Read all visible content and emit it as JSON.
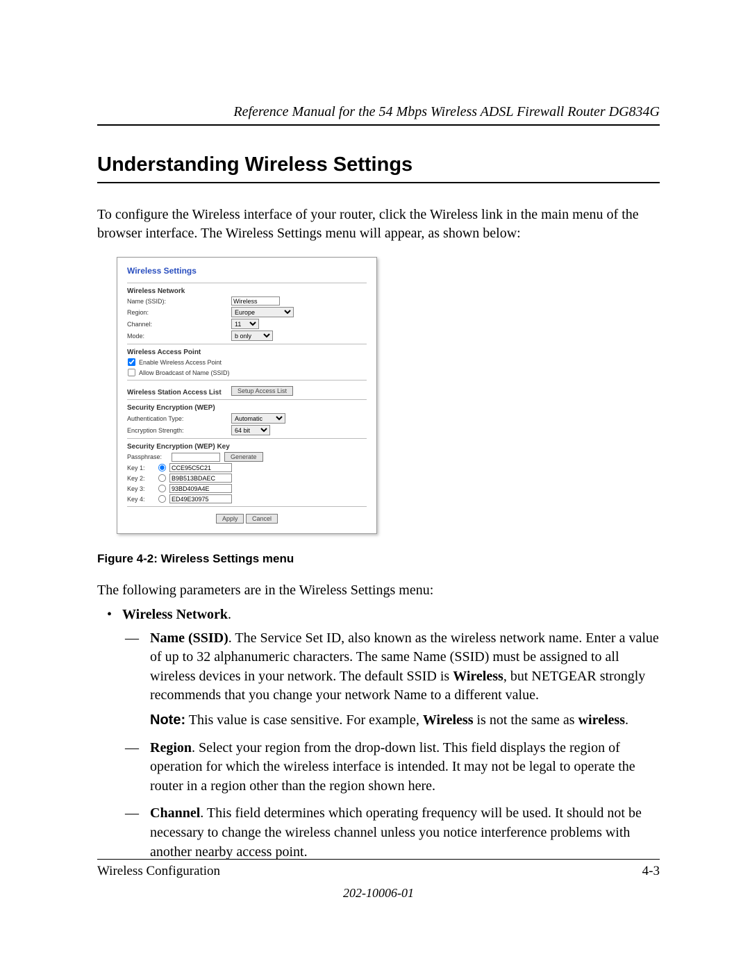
{
  "header": {
    "running_head": "Reference Manual for the 54 Mbps Wireless ADSL Firewall Router DG834G"
  },
  "title": "Understanding Wireless Settings",
  "intro": "To configure the Wireless interface of your router, click the Wireless link in the main menu of the browser interface. The Wireless Settings menu will appear, as shown below:",
  "screenshot": {
    "panel_title": "Wireless Settings",
    "sect_network": "Wireless Network",
    "name_label": "Name (SSID):",
    "name_value": "Wireless",
    "region_label": "Region:",
    "region_value": "Europe",
    "channel_label": "Channel:",
    "channel_value": "11",
    "mode_label": "Mode:",
    "mode_value": "b only",
    "sect_ap": "Wireless Access Point",
    "enable_ap": "Enable Wireless Access Point",
    "allow_broadcast": "Allow Broadcast of Name (SSID)",
    "sect_station": "Wireless Station Access List",
    "setup_access_btn": "Setup Access List",
    "sect_wep": "Security Encryption (WEP)",
    "auth_label": "Authentication Type:",
    "auth_value": "Automatic",
    "strength_label": "Encryption Strength:",
    "strength_value": "64 bit",
    "sect_wep_key": "Security Encryption (WEP) Key",
    "passphrase_label": "Passphrase:",
    "generate_btn": "Generate",
    "key1_label": "Key 1:",
    "key1_value": "CCE95C5C21",
    "key2_label": "Key 2:",
    "key2_value": "B9B513BDAEC",
    "key3_label": "Key 3:",
    "key3_value": "93BD409A4E",
    "key4_label": "Key 4:",
    "key4_value": "ED49E30975",
    "apply_btn": "Apply",
    "cancel_btn": "Cancel"
  },
  "figure_caption": "Figure 4-2:  Wireless Settings menu",
  "following": "The following parameters are in the Wireless Settings menu:",
  "bullets": {
    "wireless_network_head": "Wireless Network",
    "ssid": {
      "head": "Name (SSID)",
      "text_a": ". The Service Set ID, also known as the wireless network name. Enter a value of up to 32 alphanumeric characters. The same Name (SSID) must be assigned to all wireless devices in your network. The default SSID is ",
      "bold_default": "Wireless",
      "text_b": ", but NETGEAR strongly recommends that you change your network Name to a different value.",
      "note_label": "Note:",
      "note_a": " This value is case sensitive. For example, ",
      "note_bold1": "Wireless",
      "note_mid": " is not the same as ",
      "note_bold2": "wireless",
      "note_end": "."
    },
    "region": {
      "head": "Region",
      "text": ". Select your region from the drop-down list. This field displays the region of operation for which the wireless interface is intended. It may not be legal to operate the router in a region other than the region shown here."
    },
    "channel": {
      "head": "Channel",
      "text": ". This field determines which operating frequency will be used. It should not be necessary to change the wireless channel unless you notice interference problems with another nearby access point."
    }
  },
  "footer": {
    "left": "Wireless Configuration",
    "right": "4-3",
    "docnum": "202-10006-01"
  }
}
